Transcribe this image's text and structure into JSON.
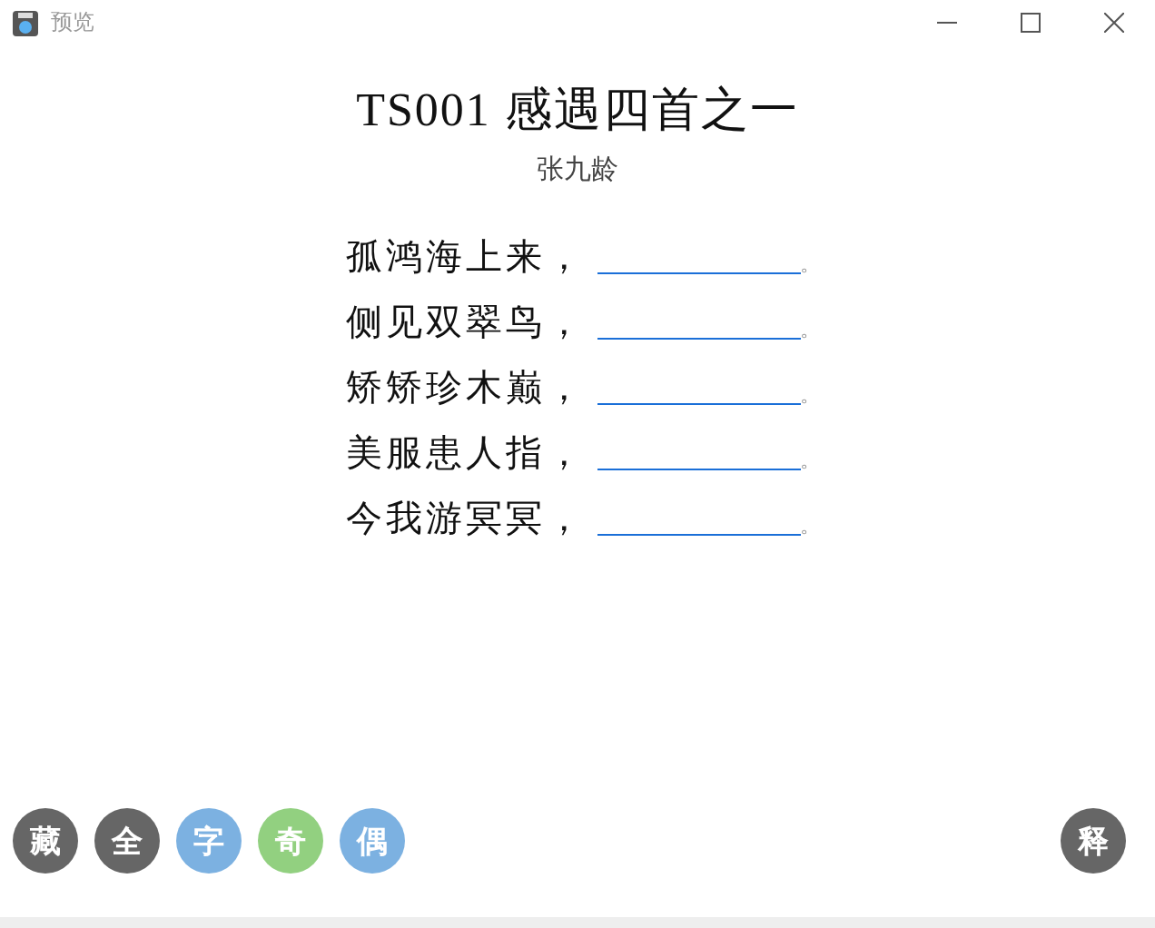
{
  "window": {
    "title": "预览"
  },
  "poem": {
    "title": "TS001 感遇四首之一",
    "author": "张九龄"
  },
  "lines": [
    {
      "text": "孤鸿海上来，",
      "end": "。"
    },
    {
      "text": "侧见双翠鸟，",
      "end": "。"
    },
    {
      "text": "矫矫珍木巅，",
      "end": "。"
    },
    {
      "text": "美服患人指，",
      "end": "。"
    },
    {
      "text": "今我游冥冥，",
      "end": "。"
    }
  ],
  "left_buttons": [
    {
      "label": "藏",
      "color": "#666666"
    },
    {
      "label": "全",
      "color": "#666666"
    },
    {
      "label": "字",
      "color": "#7cb1e1"
    },
    {
      "label": "奇",
      "color": "#92d080"
    },
    {
      "label": "偶",
      "color": "#7cb1e1"
    }
  ],
  "right_button": {
    "label": "释",
    "color": "#666666"
  }
}
